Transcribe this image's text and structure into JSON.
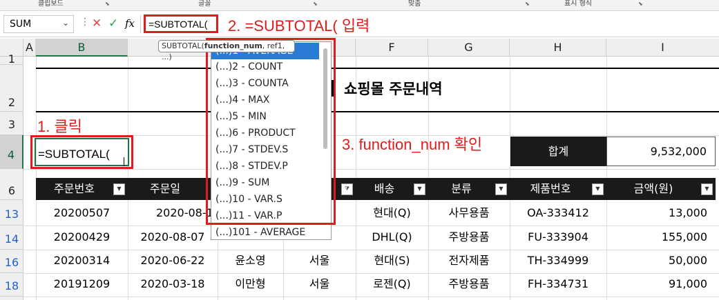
{
  "ribbon": {
    "groups": [
      "클립보드",
      "글꼴",
      "맞춤",
      "표시 형식"
    ]
  },
  "formula_bar": {
    "name_box": "SUM",
    "formula": "=SUBTOTAL(",
    "cancel_icon": "x-icon",
    "enter_icon": "check-icon",
    "fx_label": "fx"
  },
  "annotations": {
    "step1": "1. 클릭",
    "step2": "2. =SUBTOTAL( 입력",
    "step3": "3. function_num 확인"
  },
  "tooltip": {
    "prefix": "SUBTOTAL(",
    "bold_arg": "function_num",
    "rest": ", ref1, ...)"
  },
  "autocomplete": {
    "items": [
      {
        "icon": "(...)",
        "label": "1 - AVERAGE"
      },
      {
        "icon": "(...)",
        "label": "2 - COUNT"
      },
      {
        "icon": "(...)",
        "label": "3 - COUNTA"
      },
      {
        "icon": "(...)",
        "label": "4 - MAX"
      },
      {
        "icon": "(...)",
        "label": "5 - MIN"
      },
      {
        "icon": "(...)",
        "label": "6 - PRODUCT"
      },
      {
        "icon": "(...)",
        "label": "7 - STDEV.S"
      },
      {
        "icon": "(...)",
        "label": "8 - STDEV.P"
      },
      {
        "icon": "(...)",
        "label": "9 - SUM"
      },
      {
        "icon": "(...)",
        "label": "10 - VAR.S"
      },
      {
        "icon": "(...)",
        "label": "11 - VAR.P"
      },
      {
        "icon": "(...)",
        "label": "101 - AVERAGE"
      }
    ]
  },
  "grid": {
    "columns": [
      "A",
      "B",
      "C",
      "D",
      "E",
      "F",
      "G",
      "H",
      "I"
    ],
    "rows": [
      "1",
      "2",
      "3",
      "4",
      "6",
      "13",
      "14",
      "16",
      "18"
    ],
    "active_cell_text": "=SUBTOTAL(",
    "title": "쇼핑몰 주문내역",
    "sum_label": "합계",
    "sum_value": "9,532,000",
    "headers": [
      "주문번호",
      "주문일",
      "",
      "",
      "배송",
      "분류",
      "제품번호",
      "금액(원)"
    ],
    "data": [
      [
        "20200507",
        "2020-08-1",
        "",
        "",
        "현대(Q)",
        "사무용품",
        "OA-333412",
        "13,000"
      ],
      [
        "20200429",
        "2020-08-07",
        "",
        "",
        "DHL(Q)",
        "주방용품",
        "FU-333904",
        "155,000"
      ],
      [
        "20200314",
        "2020-06-22",
        "윤소영",
        "서울",
        "현대(S)",
        "전자제품",
        "TH-334999",
        "50,000"
      ],
      [
        "20191209",
        "2020-03-18",
        "이만형",
        "서울",
        "로젠(Q)",
        "주방용품",
        "FH-334731",
        "91,000"
      ]
    ]
  }
}
